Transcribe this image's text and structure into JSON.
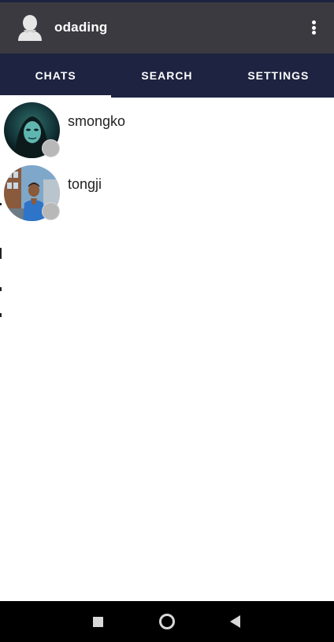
{
  "appbar": {
    "title": "odading",
    "avatar_icon": "person-silhouette-icon",
    "menu_icon": "more-vertical-icon"
  },
  "tabs": [
    {
      "label": "CHATS",
      "active": true
    },
    {
      "label": "SEARCH",
      "active": false
    },
    {
      "label": "SETTINGS",
      "active": false
    }
  ],
  "chats": [
    {
      "name": "smongko",
      "status": "offline"
    },
    {
      "name": "tongji",
      "status": "offline"
    }
  ],
  "navbar": {
    "recent_icon": "square-recents-icon",
    "home_icon": "circle-home-icon",
    "back_icon": "triangle-back-icon"
  },
  "colors": {
    "appbar": "#3a3a40",
    "tabs": "#1d2340",
    "status_offline": "#b8b8b8",
    "navbar": "#000000"
  }
}
